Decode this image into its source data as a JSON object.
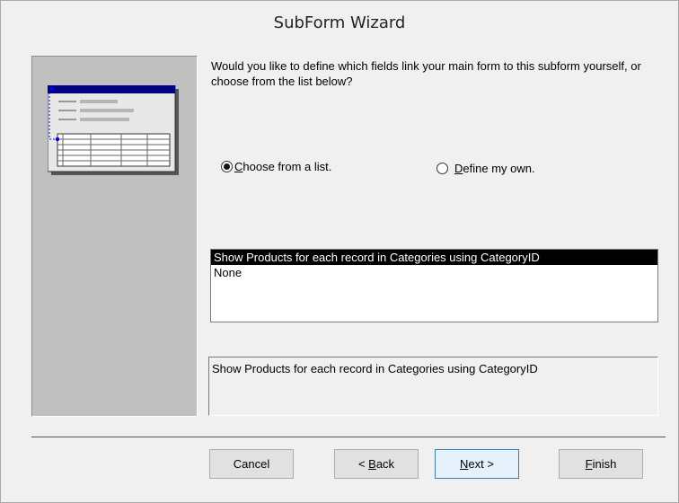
{
  "window": {
    "title": "SubForm Wizard"
  },
  "prompt": {
    "question": "Would you like to define which fields link your main form to this subform yourself, or choose from the list below?"
  },
  "options": {
    "choose_from_list": {
      "mnemonic": "C",
      "rest": "hoose from a list.",
      "selected": true
    },
    "define_my_own": {
      "mnemonic": "D",
      "rest": "efine my own.",
      "selected": false
    }
  },
  "link_list": {
    "items": [
      "Show Products for each record in Categories using CategoryID",
      "None"
    ],
    "selected_index": 0
  },
  "description": {
    "text": "Show Products for each record in Categories using CategoryID"
  },
  "buttons": {
    "cancel": "Cancel",
    "back_prefix": "< ",
    "back_mnemonic": "B",
    "back_rest": "ack",
    "next_mnemonic": "N",
    "next_rest": "ext >",
    "finish_mnemonic": "F",
    "finish_rest": "inish"
  },
  "colors": {
    "panel": "#c0c0c0",
    "selection_bg": "#000000",
    "illustration_header": "#000080",
    "link_line": "#0000ff"
  }
}
